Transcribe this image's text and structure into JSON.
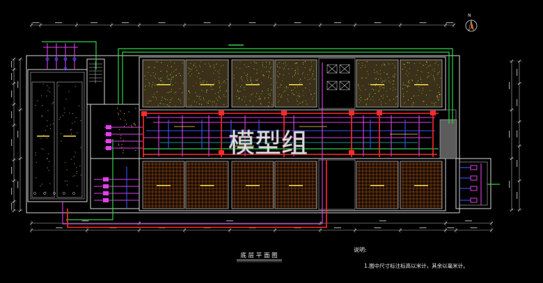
{
  "drawing": {
    "title": "底 层 平 面 图",
    "watermark": "模型组",
    "north_label": "N",
    "notes": {
      "header": "说明:",
      "lines": [
        "1.图中尺寸标注标高以米计，其余以毫米计。"
      ]
    }
  },
  "colors": {
    "background": "#000000",
    "wall": "#d8d8d8",
    "pipe_green": "#2fd34a",
    "pipe_red": "#ff2a2a",
    "pipe_magenta": "#e040e8",
    "pipe_blue": "#3a55ff",
    "accent_yellow": "#ffe24a",
    "north_arrow": "#ff6a00"
  }
}
